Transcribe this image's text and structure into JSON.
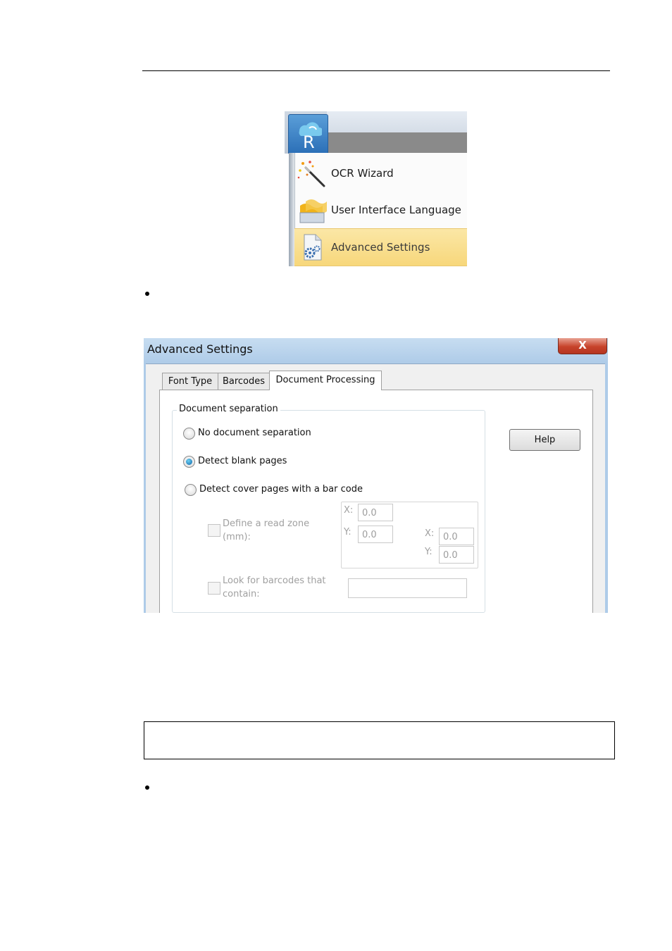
{
  "menu": {
    "items": [
      {
        "label": "OCR Wizard",
        "icon": "magic-wand-icon"
      },
      {
        "label": "User Interface Language",
        "icon": "language-flags-icon"
      },
      {
        "label": "Advanced Settings",
        "icon": "settings-gear-document-icon",
        "highlighted": true
      }
    ],
    "app_button_letter": "R"
  },
  "dialog": {
    "title": "Advanced Settings",
    "close_glyph": "X",
    "tabs": [
      {
        "label": "Font Type"
      },
      {
        "label": "Barcodes"
      },
      {
        "label": "Document Processing",
        "active": true
      }
    ],
    "help_label": "Help",
    "group_title": "Document separation",
    "options": [
      {
        "label": "No document separation",
        "checked": false
      },
      {
        "label": "Detect blank pages",
        "checked": true
      },
      {
        "label": "Detect cover pages with a bar code",
        "checked": false
      }
    ],
    "read_zone": {
      "label_line1": "Define a read zone",
      "label_line2": "(mm):",
      "x_label": "X:",
      "y_label": "Y:",
      "x1": "0.0",
      "y1": "0.0",
      "x2": "0.0",
      "y2": "0.0"
    },
    "barcode_filter": {
      "label_line1": "Look for barcodes that",
      "label_line2": "contain:",
      "value": ""
    }
  },
  "colors": {
    "menu_highlight": "#f7d77b",
    "app_button": "#2b6fb7",
    "dialog_title_bar": "#aecbe8",
    "close_button": "#c7432b",
    "radio_checked": "#0b63a8"
  }
}
